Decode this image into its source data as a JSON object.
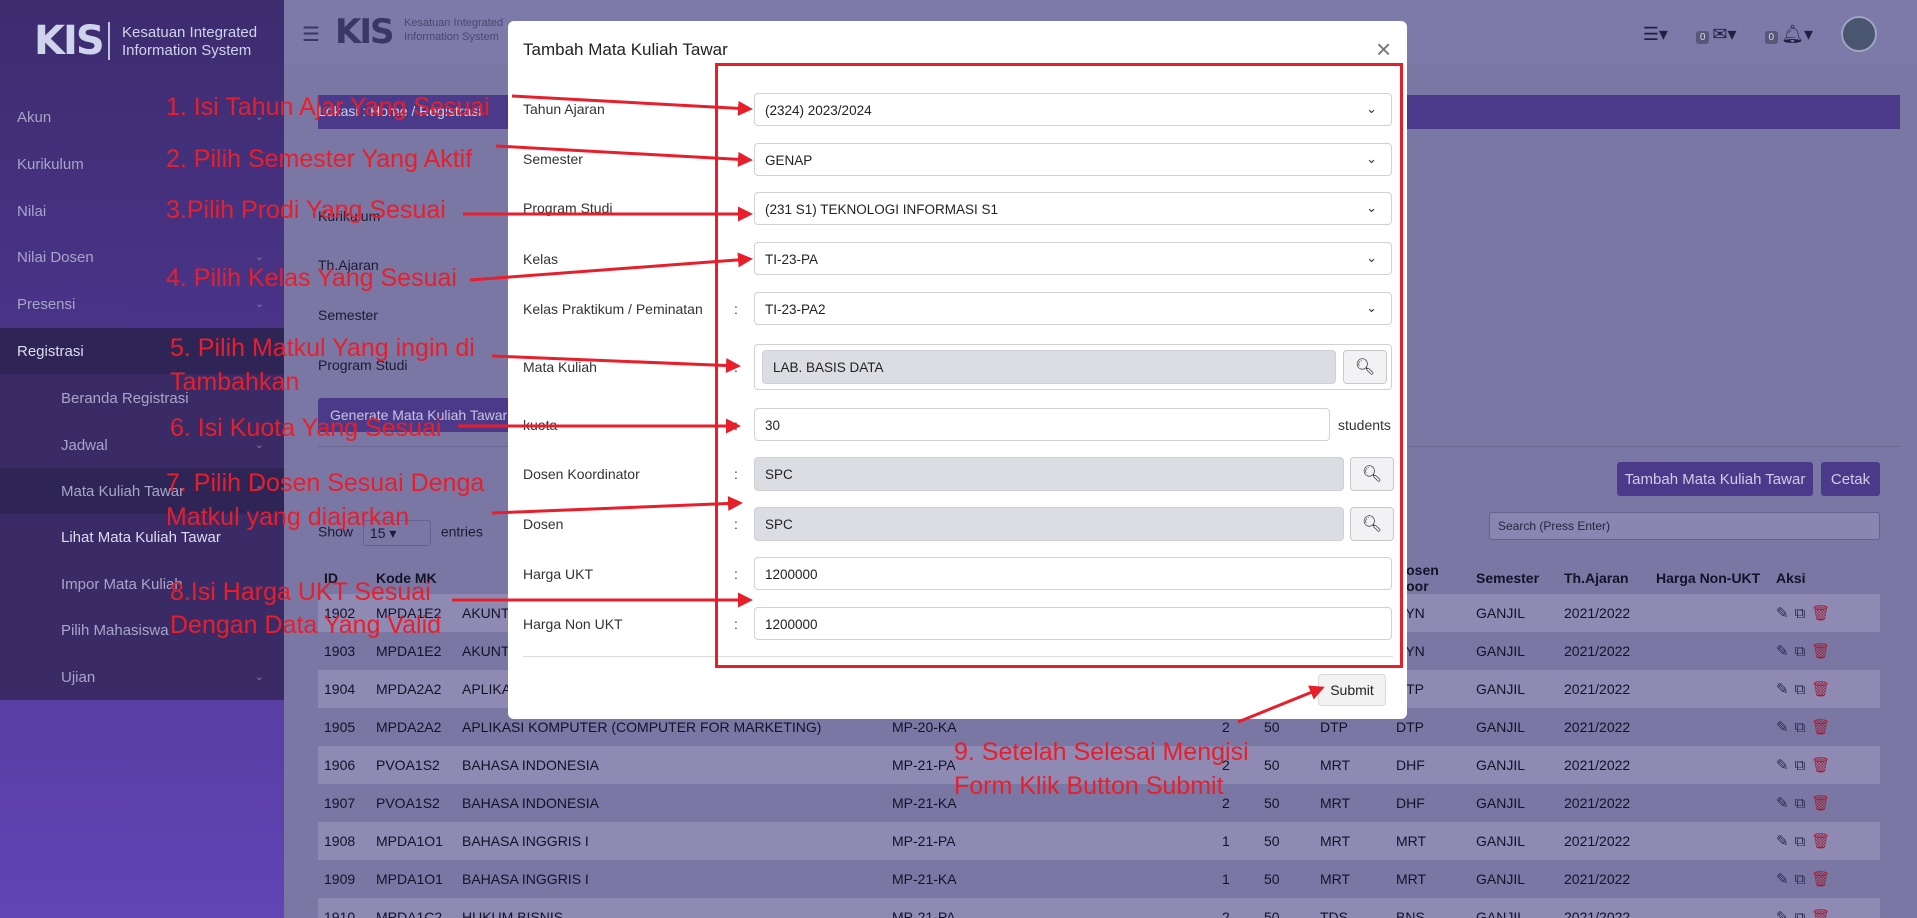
{
  "app": {
    "logo_text": "KIS",
    "name_line1": "Kesatuan Integrated",
    "name_line2": "Information System"
  },
  "sidebar": {
    "items": [
      {
        "label": "Akun",
        "chevron": true
      },
      {
        "label": "Kurikulum",
        "chevron": false
      },
      {
        "label": "Nilai",
        "chevron": false
      },
      {
        "label": "Nilai Dosen",
        "chevron": true
      },
      {
        "label": "Presensi",
        "chevron": true
      },
      {
        "label": "Registrasi",
        "chevron": false
      }
    ],
    "sub_items": [
      {
        "label": "Beranda Registrasi"
      },
      {
        "label": "Jadwal",
        "chevron": true
      },
      {
        "label": "Mata Kuliah Tawar",
        "chevron": true
      },
      {
        "label": "Lihat Mata Kuliah Tawar"
      },
      {
        "label": "Impor Mata Kuliah"
      },
      {
        "label": "Pilih Mahasiswa"
      },
      {
        "label": "Ujian",
        "chevron": true
      }
    ]
  },
  "topbar": {
    "menu_icon": "hamburger-icon",
    "mail_count": "0",
    "notif_count": "0"
  },
  "breadcrumb": "Lokasi : Home / Registrasi",
  "filter": {
    "kurikulum_label": "Kurikulum",
    "th_ajaran_label": "Th.Ajaran",
    "semester_label": "Semester",
    "prodi_label": "Program Studi",
    "generate_button": "Generate Mata Kuliah Tawar"
  },
  "toolbar": {
    "add_button": "Tambah Mata Kuliah Tawar",
    "print_button": "Cetak",
    "show_label": "Show",
    "show_value": "15",
    "entries_label": "entries",
    "search_placeholder": "Search (Press Enter)"
  },
  "table": {
    "headers": [
      "ID",
      "Kode MK",
      "",
      "",
      "",
      "",
      "",
      "",
      "Dosen Koor",
      "Semester",
      "Th.Ajaran",
      "Harga Non-UKT",
      "Aksi"
    ],
    "rows": [
      [
        "1902",
        "MPDA1E2",
        "AKUNTANSI",
        "",
        "",
        "",
        "",
        "",
        "YYN",
        "GANJIL",
        "2021/2022",
        ""
      ],
      [
        "1903",
        "MPDA1E2",
        "AKUNTANSI",
        "",
        "",
        "",
        "",
        "",
        "YYN",
        "GANJIL",
        "2021/2022",
        ""
      ],
      [
        "1904",
        "MPDA2A2",
        "APLIKASI",
        "",
        "",
        "",
        "",
        "",
        "DTP",
        "GANJIL",
        "2021/2022",
        ""
      ],
      [
        "1905",
        "MPDA2A2",
        "APLIKASI KOMPUTER (COMPUTER FOR MARKETING)",
        "MP-20-KA",
        "2",
        "50",
        "DTP",
        "",
        "DTP",
        "GANJIL",
        "2021/2022",
        ""
      ],
      [
        "1906",
        "PVOA1S2",
        "BAHASA INDONESIA",
        "MP-21-PA",
        "2",
        "50",
        "MRT",
        "",
        "DHF",
        "GANJIL",
        "2021/2022",
        ""
      ],
      [
        "1907",
        "PVOA1S2",
        "BAHASA INDONESIA",
        "MP-21-KA",
        "2",
        "50",
        "MRT",
        "",
        "DHF",
        "GANJIL",
        "2021/2022",
        ""
      ],
      [
        "1908",
        "MPDA1O1",
        "BAHASA INGGRIS I",
        "MP-21-PA",
        "1",
        "50",
        "MRT",
        "",
        "MRT",
        "GANJIL",
        "2021/2022",
        ""
      ],
      [
        "1909",
        "MPDA1O1",
        "BAHASA INGGRIS I",
        "MP-21-KA",
        "1",
        "50",
        "MRT",
        "",
        "MRT",
        "GANJIL",
        "2021/2022",
        ""
      ],
      [
        "1910",
        "MPDA1C2",
        "HUKUM BISNIS",
        "MP-21-PA",
        "2",
        "50",
        "TDS",
        "",
        "BNS",
        "GANJIL",
        "2021/2022",
        ""
      ]
    ]
  },
  "modal": {
    "title": "Tambah Mata Kuliah Tawar",
    "close": "×",
    "colon": ":",
    "fields": {
      "tahun_ajaran": {
        "label": "Tahun Ajaran",
        "value": "(2324) 2023/2024"
      },
      "semester": {
        "label": "Semester",
        "value": "GENAP"
      },
      "program_studi": {
        "label": "Program Studi",
        "value": "(231 S1) TEKNOLOGI INFORMASI S1"
      },
      "kelas": {
        "label": "Kelas",
        "value": "TI-23-PA"
      },
      "kelas_praktikum": {
        "label": "Kelas Praktikum / Peminatan",
        "value": "TI-23-PA2"
      },
      "mata_kuliah": {
        "label": "Mata Kuliah",
        "value": "LAB. BASIS DATA"
      },
      "kuota": {
        "label": "kuota",
        "value": "30",
        "suffix": "students"
      },
      "dosen_koordinator": {
        "label": "Dosen Koordinator",
        "value": "SPC"
      },
      "dosen": {
        "label": "Dosen",
        "value": "SPC"
      },
      "harga_ukt": {
        "label": "Harga UKT",
        "value": "1200000"
      },
      "harga_non_ukt": {
        "label": "Harga Non UKT",
        "value": "1200000"
      }
    },
    "submit": "Submit"
  },
  "annotations": {
    "a1": "1. Isi Tahun Ajar Yang Sesuai",
    "a2": "2. Pilih Semester Yang Aktif",
    "a3": "3.Pilih Prodi Yang Sesuai",
    "a4": "4. Pilih Kelas Yang Sesuai",
    "a5_l1": "5. Pilih Matkul Yang ingin di",
    "a5_l2": "Tambahkan",
    "a6": "6. Isi Kuota Yang Sesuai",
    "a7_l1": "7. Pilih Dosen Sesuai Denga",
    "a7_l2": "Matkul yang diajarkan",
    "a8_l1": "8.Isi Harga UKT Sesuai",
    "a8_l2": "Dengan Data Yang Valid",
    "a9_l1": "9. Setelah Selesai Mengisi",
    "a9_l2": "Form Klik Button Submit"
  },
  "colors": {
    "annotation_red": "#e81f2b",
    "sidebar_purple": "#52399b",
    "button_purple": "#4b3a8a"
  }
}
